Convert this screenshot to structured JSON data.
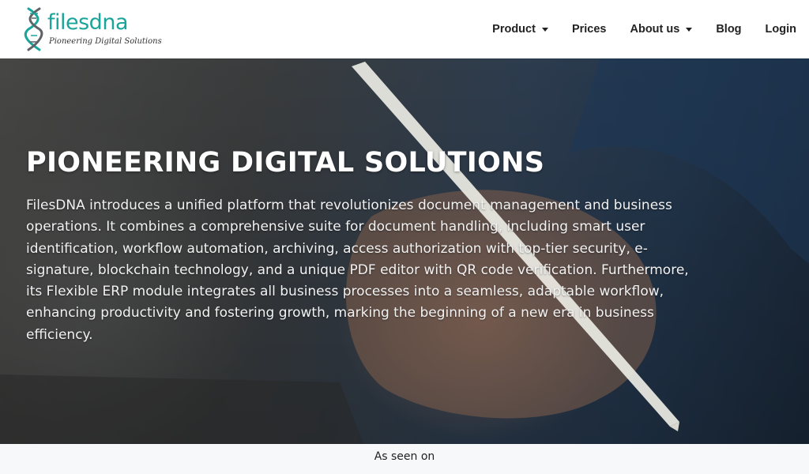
{
  "brand": {
    "name": "filesdna",
    "tagline": "Pioneering Digital Solutions",
    "icon": "dna-helix-icon",
    "color": "#1aa59a"
  },
  "nav": {
    "items": [
      {
        "label": "Product",
        "has_dropdown": true
      },
      {
        "label": "Prices",
        "has_dropdown": false
      },
      {
        "label": "About us",
        "has_dropdown": true
      },
      {
        "label": "Blog",
        "has_dropdown": false
      },
      {
        "label": "Login",
        "has_dropdown": false
      }
    ]
  },
  "hero": {
    "title": "PIONEERING DIGITAL SOLUTIONS",
    "text": "FilesDNA introduces a unified platform that revolutionizes document management and business operations. It combines a comprehensive suite for document handling, including smart user identification, workflow automation, archiving, access authorization with top-tier security, e-signature, blockchain technology, and a unique PDF editor with QR code verification. Furthermore, its Flexible ERP module integrates all business processes into a seamless, adaptable workflow, enhancing productivity and fostering growth, marking the beginning of a new era in business efficiency."
  },
  "seen": {
    "label": "As seen on"
  }
}
